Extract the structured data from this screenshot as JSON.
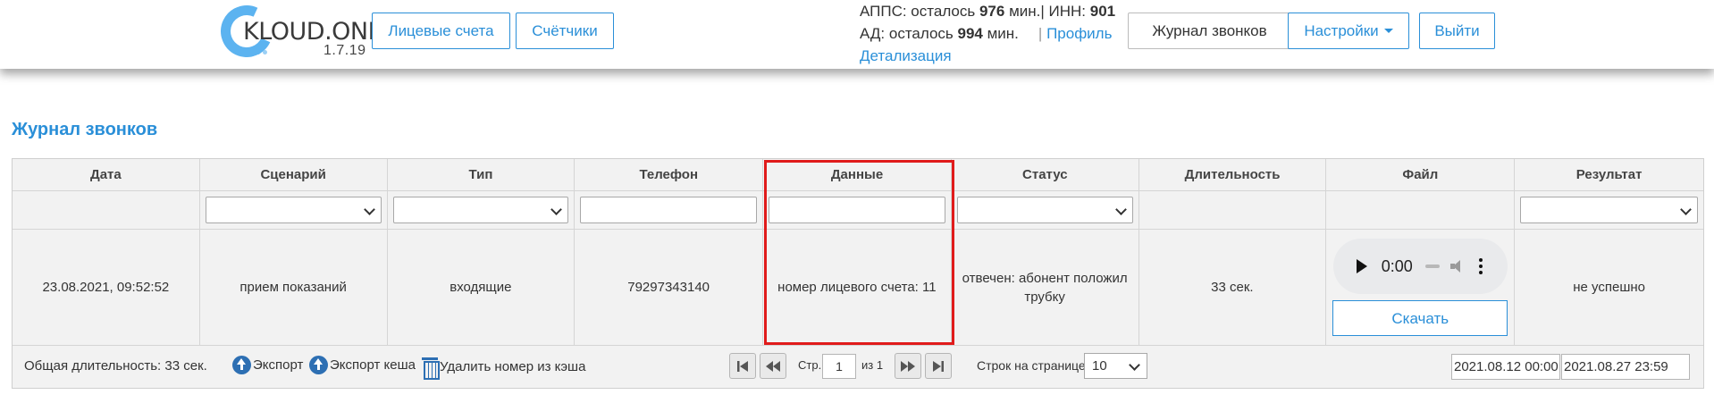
{
  "app": {
    "logo_text": "KLOUD.ONE",
    "version": "1.7.19"
  },
  "nav": {
    "accounts": "Лицевые счета",
    "meters": "Счётчики",
    "journal": "Журнал звонков",
    "settings": "Настройки",
    "logout": "Выйти"
  },
  "info": {
    "appc_prefix": "АППС: осталось ",
    "appc_value": "976",
    "appc_suffix": " мин.",
    "sep1": "| ИНН: ",
    "inn": "901",
    "ad_prefix": "АД: осталось ",
    "ad_value": "994",
    "ad_suffix": " мин.",
    "sep2": "| ",
    "profile": "Профиль",
    "details": "Детализация"
  },
  "page": {
    "title": "Журнал звонков"
  },
  "table": {
    "columns": [
      "Дата",
      "Сценарий",
      "Тип",
      "Телефон",
      "Данные",
      "Статус",
      "Длительность",
      "Файл",
      "Результат"
    ],
    "rows": [
      {
        "date": "23.08.2021, 09:52:52",
        "scenario": "прием показаний",
        "type": "входящие",
        "phone": "79297343140",
        "data": "номер лицевого счета: 11",
        "status": "отвечен: абонент положил трубку",
        "duration": "33 сек.",
        "audio_time": "0:00",
        "download": "Скачать",
        "result": "не успешно"
      }
    ],
    "highlight_color": "#e01b1b"
  },
  "footer": {
    "total": "Общая длительность: 33 сек.",
    "export": "Экспорт",
    "export_cache": "Экспорт кеша",
    "delete_cache": "Удалить номер из кэша",
    "page_label": "Стр.",
    "page_value": "1",
    "of_label": "из 1",
    "rows_label": "Строк на странице:",
    "rows_value": "10",
    "date_from": "2021.08.12 00:00",
    "date_to": "2021.08.27 23:59"
  },
  "colors": {
    "accent": "#2a8fd8",
    "logo": "#5cb3f0"
  }
}
